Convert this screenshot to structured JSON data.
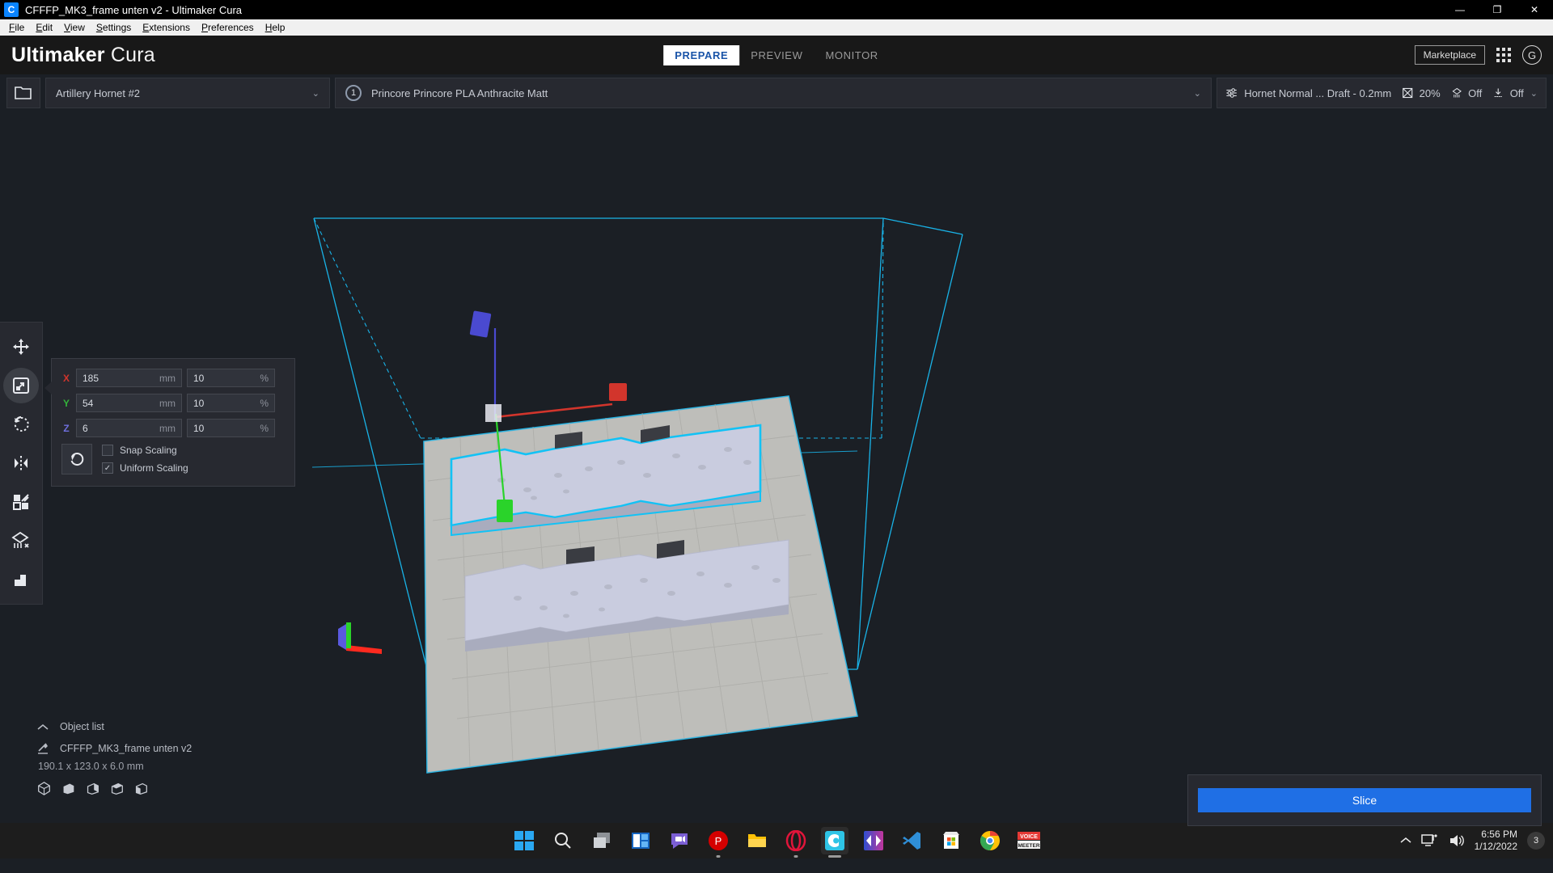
{
  "window": {
    "title": "CFFFP_MK3_frame unten v2 - Ultimaker Cura",
    "app_icon": "cura-icon",
    "minimize_label": "—",
    "restore_label": "❐",
    "close_label": "✕"
  },
  "menubar": {
    "items": [
      {
        "label": "File"
      },
      {
        "label": "Edit"
      },
      {
        "label": "View"
      },
      {
        "label": "Settings"
      },
      {
        "label": "Extensions"
      },
      {
        "label": "Preferences"
      },
      {
        "label": "Help"
      }
    ]
  },
  "header": {
    "brand_bold": "Ultimaker",
    "brand_light": "Cura",
    "tabs": [
      {
        "label": "PREPARE",
        "active": true
      },
      {
        "label": "PREVIEW",
        "active": false
      },
      {
        "label": "MONITOR",
        "active": false
      }
    ],
    "marketplace_label": "Marketplace",
    "plugins_icon": "apps-grid-icon",
    "account_initial": "G",
    "accent_color": "#1a54a8"
  },
  "config_bar": {
    "open_file_icon": "folder-open-icon",
    "printer": {
      "name": "Artillery Hornet #2",
      "chevron": "⌄"
    },
    "material": {
      "extruder_number": "1",
      "name": "Princore Princore PLA Anthracite Matt",
      "chevron": "⌄"
    },
    "print_settings": {
      "profile_icon": "print-settings-sliders-icon",
      "profile": "Hornet Normal ... Draft - 0.2mm",
      "infill_icon": "infill-icon",
      "infill": "20%",
      "support_icon": "support-icon",
      "support": "Off",
      "adhesion_icon": "adhesion-icon",
      "adhesion": "Off",
      "chevron": "⌄"
    }
  },
  "toolbar": {
    "items": [
      {
        "name": "move-tool",
        "icon": "move-icon",
        "active": false
      },
      {
        "name": "scale-tool",
        "icon": "scale-icon",
        "active": true
      },
      {
        "name": "rotate-tool",
        "icon": "rotate-icon",
        "active": false
      },
      {
        "name": "mirror-tool",
        "icon": "mirror-icon",
        "active": false
      },
      {
        "name": "per-model-settings-tool",
        "icon": "per-model-settings-icon",
        "active": false
      },
      {
        "name": "support-blocker-tool",
        "icon": "support-blocker-icon",
        "active": false
      },
      {
        "name": "measure-tool",
        "icon": "measure-icon",
        "active": false
      }
    ]
  },
  "scale_panel": {
    "rows": [
      {
        "axis": "X",
        "mm": "185",
        "percent": "10"
      },
      {
        "axis": "Y",
        "mm": "54",
        "percent": "10"
      },
      {
        "axis": "Z",
        "mm": "6",
        "percent": "10"
      }
    ],
    "unit_mm": "mm",
    "unit_percent": "%",
    "reset_icon": "reset-scale-icon",
    "snap_scaling_label": "Snap Scaling",
    "snap_scaling_checked": false,
    "uniform_scaling_label": "Uniform Scaling",
    "uniform_scaling_checked": true,
    "check_glyph": "✓",
    "axis_colors": {
      "x": "#d2352c",
      "y": "#33b23a",
      "z": "#6f6fdd"
    }
  },
  "object_list": {
    "collapse_icon": "chevron-up-icon",
    "title": "Object list",
    "item_icon": "model-mesh-icon",
    "item_name": "CFFFP_MK3_frame unten v2",
    "dimensions": "190.1 x 123.0 x 6.0 mm",
    "view_icons": [
      "view-3d-icon",
      "view-front-icon",
      "view-top-icon",
      "view-left-icon",
      "view-right-icon"
    ]
  },
  "slice_panel": {
    "button_label": "Slice",
    "button_color": "#1f6fe5"
  },
  "viewport": {
    "background_color": "#1b1f25",
    "build_volume_line_color": "#19b3e8",
    "build_plate_color": "#c4c4c0",
    "model_color": "#c9ccdf",
    "selection_outline_color": "#12c2f5",
    "handle_x_color": "#d2352c",
    "handle_y_color": "#2ad32a",
    "handle_z_color": "#4a4ad0"
  },
  "taskbar": {
    "icons": [
      {
        "name": "start-button-icon",
        "label": "Start"
      },
      {
        "name": "search-icon",
        "label": "Search"
      },
      {
        "name": "task-view-icon",
        "label": "Task View"
      },
      {
        "name": "widgets-icon",
        "label": "Widgets"
      },
      {
        "name": "chat-icon",
        "label": "Chat"
      },
      {
        "name": "pdf-app-icon",
        "label": "PDF"
      },
      {
        "name": "file-explorer-icon",
        "label": "File Explorer"
      },
      {
        "name": "opera-icon",
        "label": "Opera"
      },
      {
        "name": "cura-icon",
        "label": "Ultimaker Cura"
      },
      {
        "name": "media-app-icon",
        "label": "Media"
      },
      {
        "name": "vs-code-icon",
        "label": "Visual Studio Code"
      },
      {
        "name": "microsoft-store-icon",
        "label": "Microsoft Store"
      },
      {
        "name": "chrome-icon",
        "label": "Google Chrome"
      },
      {
        "name": "voicemeeter-icon",
        "label": "Voicemeeter"
      }
    ],
    "tray": {
      "chevron_icon": "show-hidden-icons-chevron",
      "network_icon": "network-icon",
      "volume_icon": "volume-icon",
      "time": "6:56 PM",
      "date": "1/12/2022",
      "notification_count": "3"
    }
  }
}
